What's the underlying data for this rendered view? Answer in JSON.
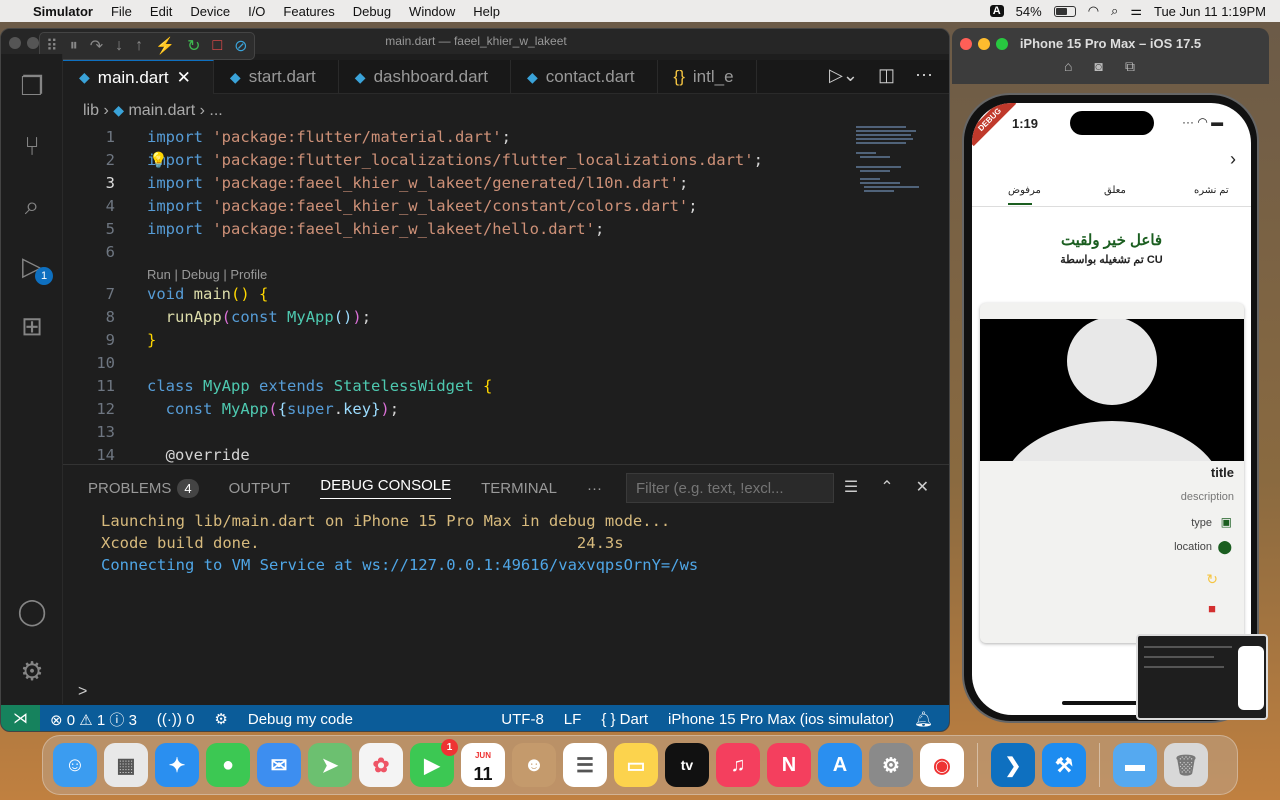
{
  "menubar": {
    "app": "Simulator",
    "items": [
      "File",
      "Edit",
      "Device",
      "I/O",
      "Features",
      "Debug",
      "Window",
      "Help"
    ],
    "input_badge": "A",
    "battery": "54%",
    "clock": "Tue Jun 11  1:19PM"
  },
  "vscode": {
    "title": "main.dart — faeel_khier_w_lakeet",
    "tabs": [
      "main.dart",
      "start.dart",
      "dashboard.dart",
      "contact.dart",
      "intl_e"
    ],
    "tab_json_icon": "{}",
    "breadcrumb": {
      "folder": "lib",
      "file": "main.dart",
      "more": "..."
    },
    "codelens": "Run | Debug | Profile",
    "run_badge": "1",
    "panel": {
      "tabs": [
        "PROBLEMS",
        "OUTPUT",
        "DEBUG CONSOLE",
        "TERMINAL"
      ],
      "problem_count": "4",
      "more": "···",
      "filter_placeholder": "Filter (e.g. text, !excl...",
      "lines": [
        "Launching lib/main.dart on iPhone 15 Pro Max in debug mode...",
        "Xcode build done.                                  24.3s",
        "Connecting to VM Service at ws://127.0.0.1:49616/vaxvqpsOrnY=/ws"
      ],
      "prompt": ">"
    },
    "status": {
      "errors": "0",
      "warnings": "1",
      "infos": "3",
      "ports": "0",
      "debug": "Debug my code",
      "encoding": "UTF-8",
      "eol": "LF",
      "lang": "Dart",
      "device": "iPhone 15 Pro Max (ios simulator)"
    }
  },
  "simulator": {
    "title": "iPhone 15 Pro Max – iOS 17.5",
    "time": "1:19",
    "debug_ribbon": "DEBUG",
    "tabs": [
      "مرفوض",
      "معلق",
      "تم نشره"
    ],
    "app_title": "فاعل خير ولقيت",
    "app_subtitle": "تم تشغيله بواسطة CU",
    "card": {
      "title": "title",
      "description": "description",
      "type": "type",
      "location": "location"
    }
  },
  "dock": [
    "Finder",
    "Launchpad",
    "Safari",
    "Messages",
    "Mail",
    "Maps",
    "Photos",
    "FaceTime",
    "Calendar",
    "Contacts",
    "Reminders",
    "Notes",
    "TV",
    "Music",
    "News",
    "App Store",
    "System Settings",
    "Chrome",
    "VS Code",
    "Xcode",
    "Downloads",
    "Trash"
  ],
  "dock_calendar": {
    "month": "JUN",
    "day": "11"
  },
  "dock_facetime_badge": "1",
  "colors": {
    "accent": "#0e70c0",
    "status_bar": "#0b5c99",
    "sim_green": "#1b5e20"
  }
}
